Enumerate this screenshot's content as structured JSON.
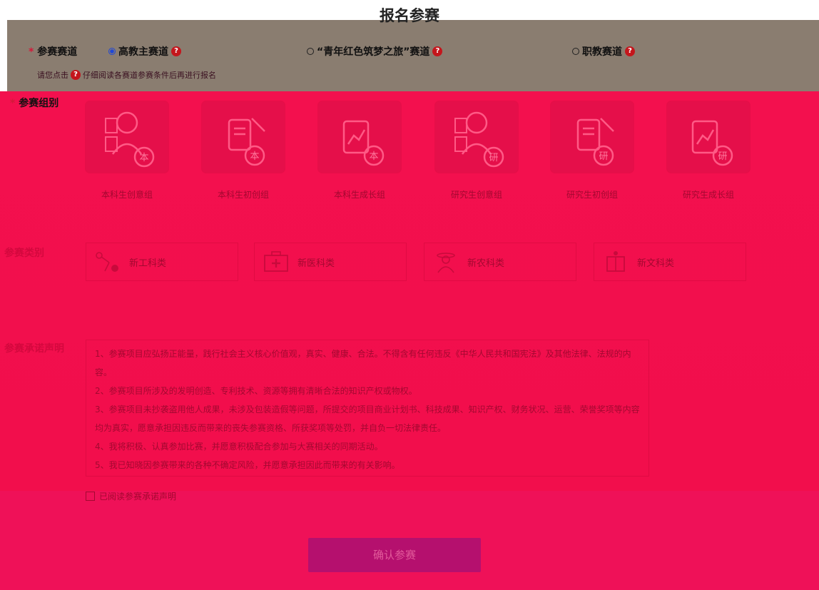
{
  "page": {
    "title": "报名参赛"
  },
  "track": {
    "label": "参赛赛道",
    "required_mark": "*",
    "options": [
      {
        "label": "高教主赛道",
        "selected": true
      },
      {
        "label": "“青年红色筑梦之旅”赛道",
        "selected": false
      },
      {
        "label": "职教赛道",
        "selected": false
      }
    ],
    "hint_before": "请您点击",
    "hint_after": "仔细阅读各赛道参赛条件后再进行报名",
    "help_glyph": "?"
  },
  "group": {
    "label": "参赛组别",
    "required_mark": "*",
    "options": [
      {
        "label": "本科生创意组",
        "badge": "本",
        "icon": "idea-person-icon"
      },
      {
        "label": "本科生初创组",
        "badge": "本",
        "icon": "document-wand-icon"
      },
      {
        "label": "本科生成长组",
        "badge": "本",
        "icon": "growth-chart-icon"
      },
      {
        "label": "研究生创意组",
        "badge": "研",
        "icon": "idea-person-icon"
      },
      {
        "label": "研究生初创组",
        "badge": "研",
        "icon": "document-wand-icon"
      },
      {
        "label": "研究生成长组",
        "badge": "研",
        "icon": "growth-chart-icon"
      }
    ]
  },
  "category": {
    "label": "参赛类别",
    "options": [
      {
        "label": "新工科类",
        "icon": "robot-arm-icon"
      },
      {
        "label": "新医科类",
        "icon": "medical-kit-icon"
      },
      {
        "label": "新农科类",
        "icon": "farmer-icon"
      },
      {
        "label": "新文科类",
        "icon": "book-icon"
      }
    ]
  },
  "pledge": {
    "label": "参赛承诺声明",
    "items": [
      "1、参赛项目应弘扬正能量，践行社会主义核心价值观，真实、健康、合法。不得含有任何违反《中华人民共和国宪法》及其他法律、法规的内容。",
      "2、参赛项目所涉及的发明创造、专利技术、资源等拥有清晰合法的知识产权或物权。",
      "3、参赛项目未抄袭盗用他人成果，未涉及包装造假等问题，所提交的项目商业计划书、科技成果、知识产权、财务状况、运营、荣誉奖项等内容均为真实，愿意承担因违反而带来的丧失参赛资格、所获奖项等处罚，并自负一切法律责任。",
      "4、我将积极、认真参加比赛，并愿意积极配合参加与大赛相关的同期活动。",
      "5、我已知晓因参赛带来的各种不确定风险，并愿意承担因此而带来的有关影响。"
    ],
    "checkbox_label": "已阅读参赛承诺声明",
    "checked": false
  },
  "actions": {
    "confirm_label": "确认参赛"
  },
  "colors": {
    "overlay_red": "#f3104e",
    "band_brown": "#8a7d70",
    "button_magenta": "#b5106e",
    "help_red": "#c4161c"
  }
}
